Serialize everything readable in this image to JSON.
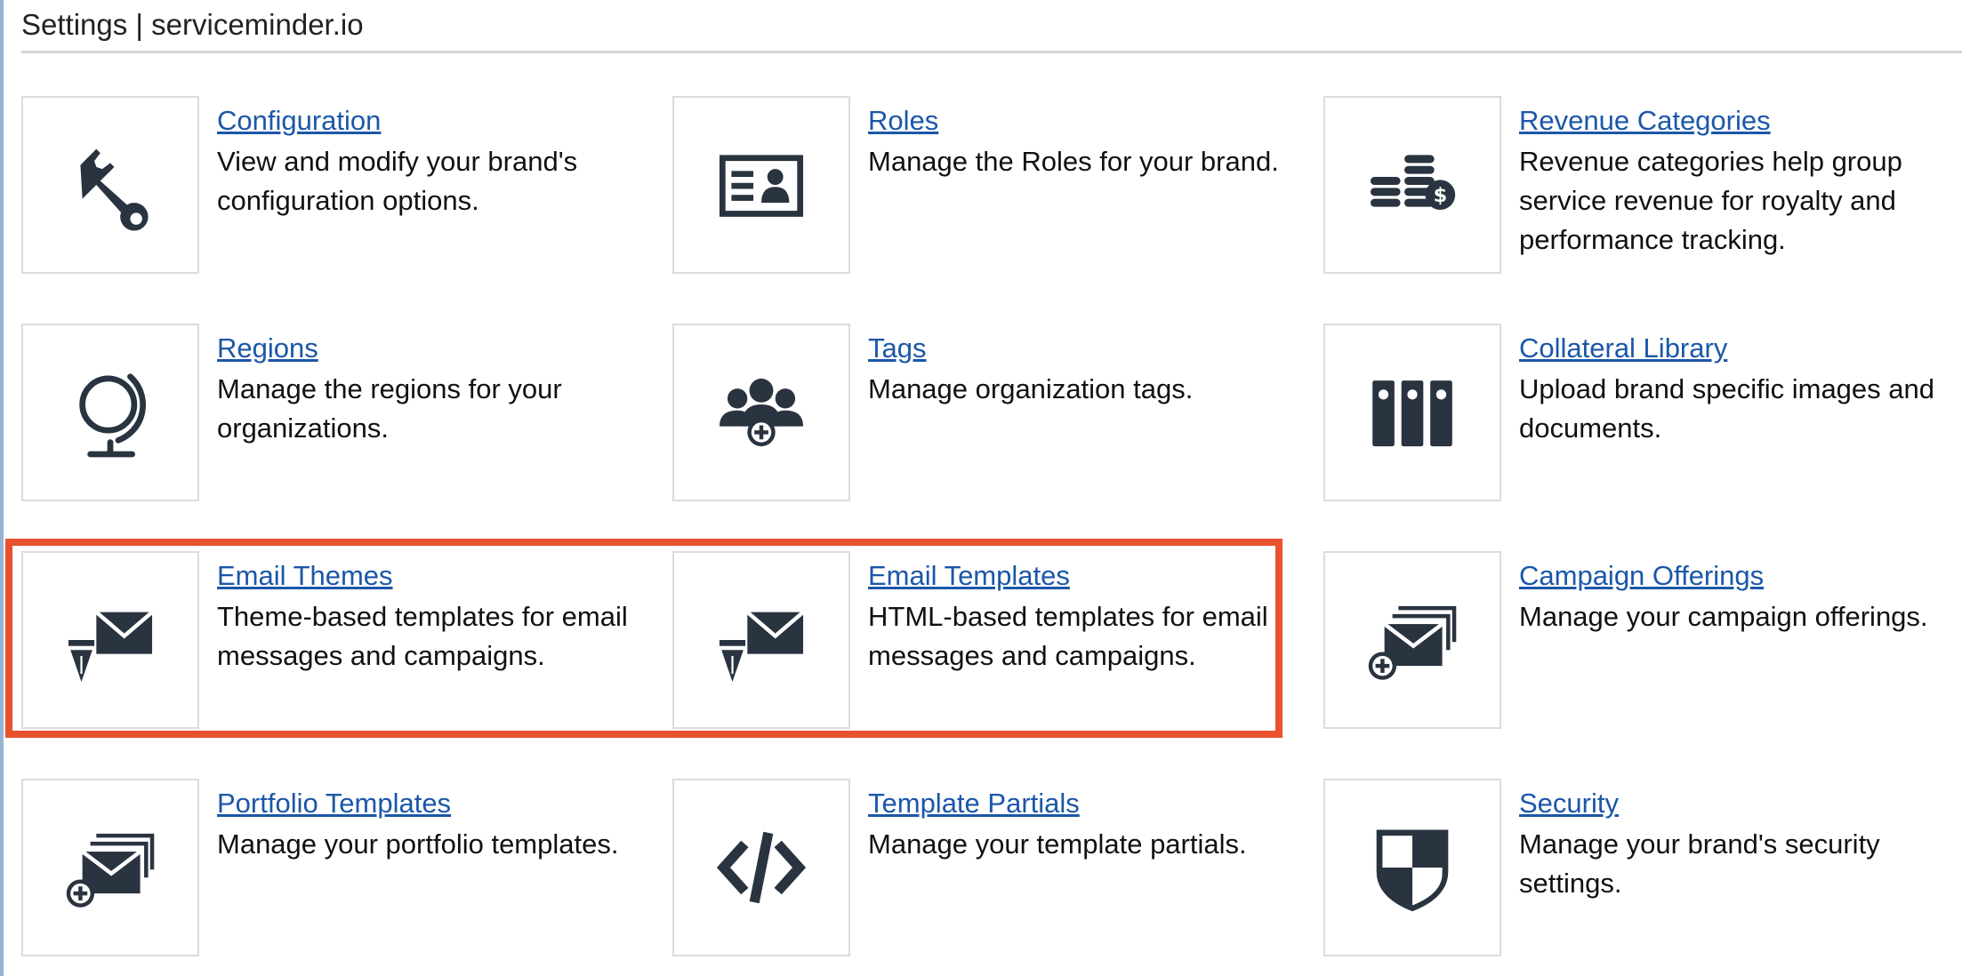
{
  "page": {
    "title": "Settings | serviceminder.io"
  },
  "colors": {
    "link": "#1b57a8",
    "icon": "#2a3340",
    "highlight": "#e9512f",
    "tile_border": "#dcdcdc"
  },
  "tiles": [
    {
      "link": "Configuration",
      "desc": "View and modify your brand's configuration options.",
      "icon": "wrench-icon"
    },
    {
      "link": "Roles",
      "desc": "Manage the Roles for your brand.",
      "icon": "id-card-icon"
    },
    {
      "link": "Revenue Categories",
      "desc": "Revenue categories help group service revenue for royalty and performance tracking.",
      "icon": "coin-stacks-icon"
    },
    {
      "link": "Regions",
      "desc": "Manage the regions for your organizations.",
      "icon": "globe-icon"
    },
    {
      "link": "Tags",
      "desc": "Manage organization tags.",
      "icon": "user-group-add-icon"
    },
    {
      "link": "Collateral Library",
      "desc": "Upload brand specific images and documents.",
      "icon": "binders-icon"
    },
    {
      "link": "Email Themes",
      "desc": "Theme-based templates for email messages and campaigns.",
      "icon": "pen-envelope-icon"
    },
    {
      "link": "Email Templates",
      "desc": "HTML-based templates for email messages and campaigns.",
      "icon": "pen-envelope-icon"
    },
    {
      "link": "Campaign Offerings",
      "desc": "Manage your campaign offerings.",
      "icon": "envelope-stack-add-icon"
    },
    {
      "link": "Portfolio Templates",
      "desc": "Manage your portfolio templates.",
      "icon": "envelope-stack-add-icon"
    },
    {
      "link": "Template Partials",
      "desc": "Manage your template partials.",
      "icon": "code-icon"
    },
    {
      "link": "Security",
      "desc": "Manage your brand's security settings.",
      "icon": "shield-icon"
    }
  ]
}
